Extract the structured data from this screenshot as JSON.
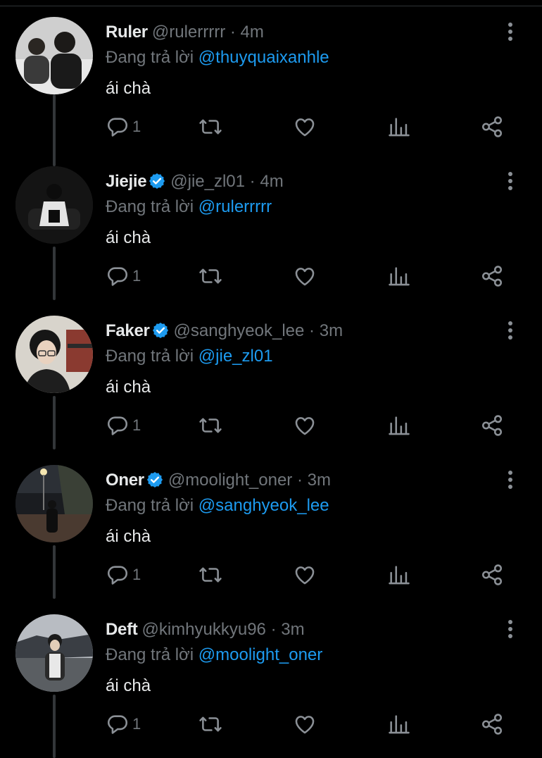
{
  "replying_prefix": "Đang trả lời",
  "colors": {
    "background": "#000000",
    "text": "#e7e9ea",
    "muted": "#71767b",
    "mention": "#1d9bf0",
    "verified": "#1d9bf0"
  },
  "icons": {
    "reply": "reply-icon",
    "retweet": "retweet-icon",
    "like": "heart-icon",
    "views": "views-icon",
    "share": "share-icon",
    "more": "more-vertical-icon",
    "verified": "verified-badge-icon"
  },
  "tweets": [
    {
      "name": "Ruler",
      "verified": false,
      "handle": "@rulerrrrr",
      "time": "4m",
      "replying_to": "@thuyquaixanhle",
      "text": "ái chà",
      "reply_count": "1"
    },
    {
      "name": "Jiejie",
      "verified": true,
      "handle": "@jie_zl01",
      "time": "4m",
      "replying_to": "@rulerrrrr",
      "text": "ái chà",
      "reply_count": "1"
    },
    {
      "name": "Faker",
      "verified": true,
      "handle": "@sanghyeok_lee",
      "time": "3m",
      "replying_to": "@jie_zl01",
      "text": "ái chà",
      "reply_count": "1"
    },
    {
      "name": "Oner",
      "verified": true,
      "handle": "@moolight_oner",
      "time": "3m",
      "replying_to": "@sanghyeok_lee",
      "text": "ái chà",
      "reply_count": "1"
    },
    {
      "name": "Deft",
      "verified": false,
      "handle": "@kimhyukkyu96",
      "time": "3m",
      "replying_to": "@moolight_oner",
      "text": "ái chà",
      "reply_count": "1"
    }
  ]
}
